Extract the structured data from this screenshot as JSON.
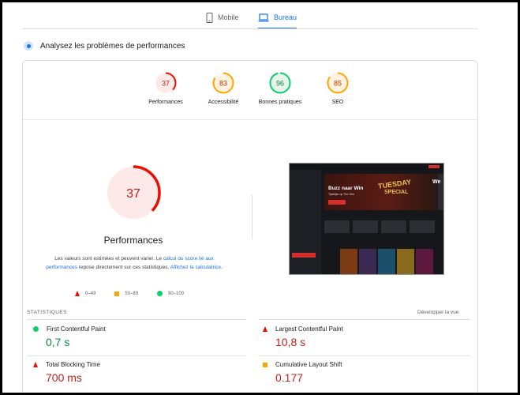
{
  "tabs": [
    {
      "label": "Mobile",
      "icon": "phone-icon",
      "selected": false
    },
    {
      "label": "Bureau",
      "icon": "laptop-icon",
      "selected": true
    }
  ],
  "header": {
    "title": "Analysez les problèmes de performances"
  },
  "scores": [
    {
      "label": "Performances",
      "value": "37",
      "score": 37,
      "color": "#eb0f00"
    },
    {
      "label": "Accessibilité",
      "value": "83",
      "score": 83,
      "color": "#ffa400"
    },
    {
      "label": "Bonnes pratiques",
      "value": "96",
      "score": 96,
      "color": "#0cce6b"
    },
    {
      "label": "SEO",
      "value": "85",
      "score": 85,
      "color": "#ffa400"
    }
  ],
  "main_score": {
    "value": "37",
    "score": 37,
    "label": "Performances",
    "color": "#eb0f00"
  },
  "description": {
    "text1": "Les valeurs sont estimées et peuvent varier. Le ",
    "link1": "calcul du score lié aux performances",
    "text2": " repose directement sur ces statistiques. ",
    "link2": "Affichez la calculatrice",
    "text3": "."
  },
  "legend": [
    {
      "range": "0–49"
    },
    {
      "range": "50–89"
    },
    {
      "range": "90–100"
    }
  ],
  "thumbnail": {
    "banner_title": "Buzz naar Win",
    "banner_sub": "Tijdelijke op The Vibe",
    "promo_line1": "TUESDAY",
    "promo_line2": "SPECIAL",
    "side_text": "We"
  },
  "stats": {
    "title": "STATISTIQUES",
    "toggle": "Développer la vue",
    "metrics": [
      {
        "name": "First Contentful Paint",
        "value": "0,7 s",
        "status": "good"
      },
      {
        "name": "Largest Contentful Paint",
        "value": "10,8 s",
        "status": "poor"
      },
      {
        "name": "Total Blocking Time",
        "value": "700 ms",
        "status": "poor"
      },
      {
        "name": "Cumulative Layout Shift",
        "value": "0.177",
        "status": "average"
      }
    ]
  }
}
